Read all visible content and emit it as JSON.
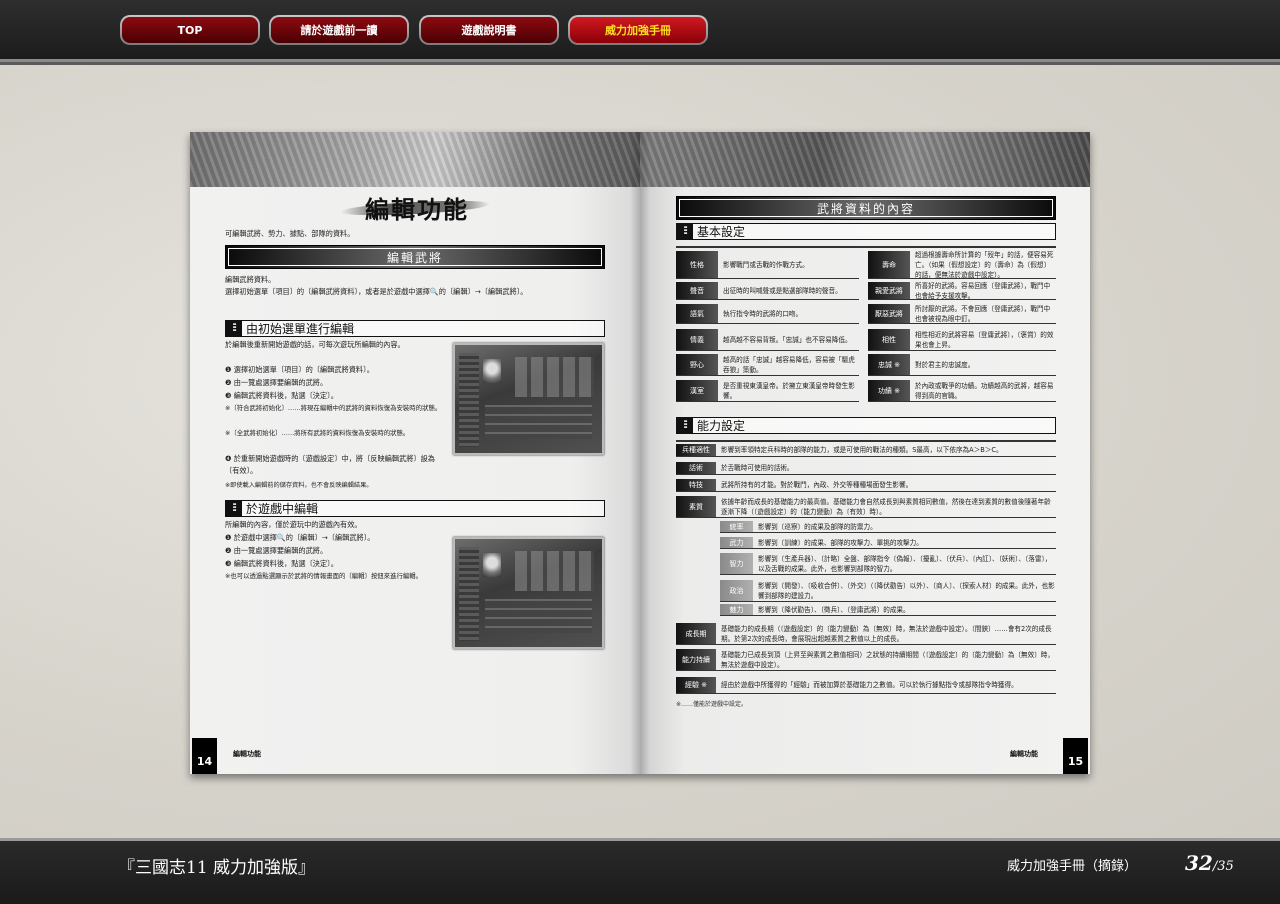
{
  "nav": {
    "buttons": [
      {
        "label": "TOP",
        "active": false
      },
      {
        "label": "請於遊戲前一讀",
        "active": false
      },
      {
        "label": "遊戲說明書",
        "active": false
      },
      {
        "label": "威力加強手冊",
        "active": true
      }
    ]
  },
  "left_page": {
    "title": "編輯功能",
    "intro": "可編輯武將、勢力、據點、部隊的資料。",
    "section_bar": "編輯武將",
    "para1": "編輯武將資料。",
    "para2": "選擇初始選單〔項目〕的〔編輯武將資料〕，或者是於遊戲中選擇🔍的〔編輯〕→〔編輯武將〕。",
    "section1": {
      "icon": "section-marker-icon",
      "title": "由初始選單進行編輯",
      "lead": "於編輯後重新開始遊戲的話，可每次遊玩所編輯的內容。",
      "steps": [
        "❶ 選擇初始選單〔項目〕的〔編輯武將資料〕。",
        "❷ 由一覽處選擇要編輯的武將。",
        "❸ 編輯武將資料後，點選〔決定〕。"
      ],
      "notes": [
        "※〔符合武將初始化〕……將現在編輯中的武將的資料恢復為安裝時的狀態。",
        "※〔全武將初始化〕……將所有武將的資料恢復為安裝時的狀態。"
      ],
      "step4": "❹ 於重新開始遊戲時的〔遊戲設定〕中，將〔反映編輯武將〕設為〔有效〕。",
      "note_end": "※即使載入編輯前的儲存資料，也不會反映編輯結果。"
    },
    "section2": {
      "icon": "section-marker-icon",
      "title": "於遊戲中編輯",
      "lead": "所編輯的內容，僅於遊玩中的遊戲內有效。",
      "steps": [
        "❶ 於遊戲中選擇🔍的〔編輯〕→〔編輯武將〕。",
        "❷ 由一覽處選擇要編輯的武將。",
        "❸ 編輯武將資料後，點選〔決定〕。"
      ],
      "note": "※也可以透過點選顯示於武將的情報畫面的〔編輯〕按鈕來進行編輯。"
    },
    "page_number": "14",
    "footer": "編輯功能"
  },
  "right_page": {
    "section_bar": "武將資料的內容",
    "basic": {
      "title": "基本設定",
      "left_rows": [
        {
          "label": "性格",
          "desc": "影響戰鬥或舌戰的作戰方式。"
        },
        {
          "label": "聲音",
          "desc": "出征時的叫喊聲或是點選部隊時的聲音。"
        },
        {
          "label": "語氣",
          "desc": "執行指令時的武將的口吻。"
        },
        {
          "label": "情義",
          "desc": "越高越不容易背叛。「忠誠」也不容易降低。"
        },
        {
          "label": "野心",
          "desc": "越高的話「忠誠」越容易降低，容易被「驅虎吞狼」策動。"
        },
        {
          "label": "漢室",
          "desc": "是否重視東漢皇帝。於擁立東漢皇帝時發生影響。"
        }
      ],
      "right_rows": [
        {
          "label": "壽命",
          "desc": "超過根據壽命所計算的「歿年」的話，便容易死亡。（如果〔假想設定〕的〔壽命〕為〔假想〕的話，便無法於遊戲中設定）。"
        },
        {
          "label": "親愛武將",
          "desc": "所喜好的武將。容易回應〔登庸武將〕，戰鬥中也會給予支援攻擊。"
        },
        {
          "label": "厭惡武將",
          "desc": "所討厭的武將。不會回應〔登庸武將〕，戰鬥中也會被視為眼中釘。"
        },
        {
          "label": "相性",
          "desc": "相性相近的武將容易〔登庸武將〕，〔褒賞〕的效果也會上昇。"
        },
        {
          "label": "忠誠 ※",
          "desc": "對於君主的忠誠度。"
        },
        {
          "label": "功績 ※",
          "desc": "於內政或戰爭的功績。功績越高的武將，越容易得到高的官職。"
        }
      ]
    },
    "ability": {
      "title": "能力設定",
      "rows": [
        {
          "label": "兵種適性",
          "desc": "影響到率領特定兵科時的部隊的能力，或是可使用的戰法的種類。S最高，以下依序為A＞B＞C。"
        },
        {
          "label": "話術",
          "desc": "於舌戰時可使用的話術。"
        },
        {
          "label": "特技",
          "desc": "武將所持有的才能。對於戰鬥，內政、外交等種種場面發生影響。"
        },
        {
          "label": "素質",
          "desc": "依據年齡而成長的基礎能力的最高值。基礎能力會自然成長到與素質相同數值，然後在達到素質的數值後隨著年齡逐漸下降（〔遊戲設定〕的〔能力變動〕為〔有效〕時）。"
        }
      ],
      "sub_rows": [
        {
          "label": "統率",
          "desc": "影響到〔巡察〕的成果及部隊的防禦力。"
        },
        {
          "label": "武力",
          "desc": "影響到〔訓練〕的成果、部隊的攻擊力、單挑的攻擊力。"
        },
        {
          "label": "智力",
          "desc": "影響到〔生產兵器〕、〔計略〕全盤、部隊指令〔偽報〕、〔擾亂〕、〔伏兵〕、〔內訌〕、〔妖術〕、〔落雷〕，以及舌戰的成果。此外，也影響到部隊的智力。"
        },
        {
          "label": "政治",
          "desc": "影響到〔開發〕、〔吸收合併〕、〔外交〕（〔降伏勸告〕以外）、〔商人〕、〔探索人材〕的成果。此外，也影響到部隊的建設力。"
        },
        {
          "label": "魅力",
          "desc": "影響到〔降伏勸告〕、〔徵兵〕、〔登庸武將〕的成果。"
        }
      ],
      "rows2": [
        {
          "label": "成長期",
          "desc": "基礎能力的成長期（〔遊戲設定〕的〔能力變動〕為〔無效〕時，無法於遊戲中設定）。〔間鋏〕……會有2次的成長期。於第2次的成長時，會展現出超越素質之數值以上的成長。"
        },
        {
          "label": "能力持續",
          "desc": "基礎能力已成長到頂（上昇至與素質之數值相同）之狀態的持續期間（〔遊戲設定〕的〔能力變動〕為〔無效〕時，無法於遊戲中設定）。"
        },
        {
          "label": "經驗 ※",
          "desc": "經由於遊戲中所獲得的「經驗」而被加算於基礎能力之數值。可以於執行據點指令或部隊指令時獲得。"
        }
      ],
      "footnote": "※……僅能於遊戲中設定。"
    },
    "page_number": "15",
    "footer": "編輯功能"
  },
  "bottom": {
    "title": "『三國志11 威力加強版』",
    "section": "威力加強手冊（摘錄）",
    "current_page": "32",
    "total_pages": "/35"
  }
}
